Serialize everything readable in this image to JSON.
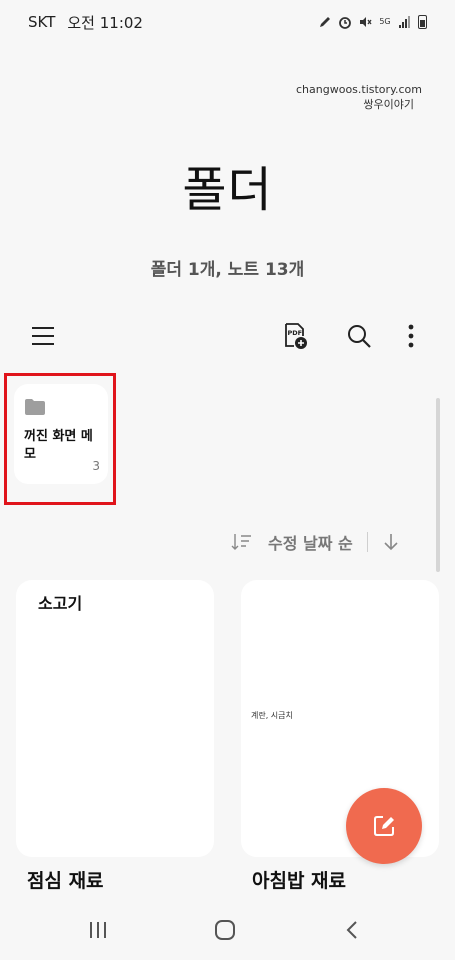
{
  "status_bar": {
    "carrier": "SKT",
    "time": "오전 11:02",
    "icons": [
      "pen-icon",
      "alarm-icon",
      "mute-icon",
      "5g-signal-icon",
      "signal-bars-icon",
      "battery-icon"
    ],
    "network": "5G"
  },
  "watermark": {
    "line1": "changwoos.tistory.com",
    "line2": "쌍우이야기"
  },
  "header": {
    "title": "폴더",
    "subtitle": "폴더 1개, 노트 13개"
  },
  "toolbar": {
    "menu_icon": "hamburger-menu-icon",
    "pdf_icon": "pdf-add-icon",
    "pdf_label": "PDF",
    "search_icon": "search-icon",
    "more_icon": "more-vertical-icon"
  },
  "folders": [
    {
      "name": "꺼진 화면 메모",
      "count": "3",
      "icon": "folder-icon"
    }
  ],
  "sort": {
    "label": "수정 날짜 순",
    "filter_icon": "sort-filter-icon",
    "direction_icon": "arrow-down-icon"
  },
  "notes": [
    {
      "body_text": "소고기",
      "title": "점심 재료"
    },
    {
      "body_text": "계란, 시금치",
      "title": "아침밥 재료"
    }
  ],
  "fab": {
    "icon": "compose-note-icon"
  },
  "navbar": {
    "recents_icon": "recents-icon",
    "home_icon": "home-icon",
    "back_icon": "back-icon"
  },
  "colors": {
    "background": "#f7f7f7",
    "card": "#ffffff",
    "fab": "#f06a4f",
    "highlight": "#e0141b",
    "secondary_text": "#777777"
  }
}
